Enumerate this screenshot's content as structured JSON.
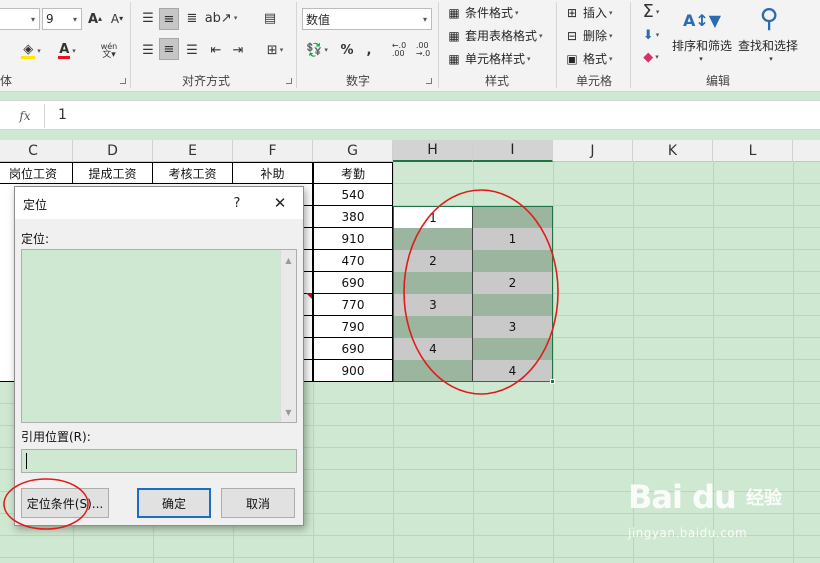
{
  "ribbon": {
    "font_size_value": "9",
    "font_group_label": "体",
    "align_group_label": "对齐方式",
    "number_group_label": "数字",
    "number_format_value": "数值",
    "percent_symbol": "%",
    "comma_symbol": ",",
    "style_group_label": "样式",
    "style_items": [
      "条件格式",
      "套用表格格式",
      "单元格样式"
    ],
    "cells_group_label": "单元格",
    "cells_items": [
      "插入",
      "删除",
      "格式"
    ],
    "edit_group_label": "编辑",
    "sort_filter_label": "排序和筛选",
    "find_select_label": "查找和选择"
  },
  "formula_bar": {
    "fx_label": "fx",
    "value": "1"
  },
  "columns": [
    "C",
    "D",
    "E",
    "F",
    "G",
    "H",
    "I",
    "J",
    "K",
    "L"
  ],
  "table": {
    "headers": [
      "岗位工资",
      "提成工资",
      "考核工资",
      "补助",
      "考勤"
    ],
    "attendance": [
      "540",
      "380",
      "910",
      "470",
      "690",
      "770",
      "790",
      "690",
      "900"
    ]
  },
  "selection_cells": {
    "h": [
      "1",
      "",
      "2",
      "",
      "3",
      "",
      "4",
      ""
    ],
    "i": [
      "",
      "1",
      "",
      "2",
      "",
      "3",
      "",
      "4"
    ]
  },
  "dialog": {
    "title": "定位",
    "help": "?",
    "close": "✕",
    "goto_label": "定位:",
    "reference_label": "引用位置(R):",
    "special_button": "定位条件(S)...",
    "ok_button": "确定",
    "cancel_button": "取消"
  },
  "watermark": {
    "brand": "Bai du",
    "cn": "经验",
    "url": "jingyan.baidu.com"
  },
  "colors": {
    "grid_bg": "#cfe8d1",
    "selection_dark": "#9bb59f",
    "selection_light": "#c9c9c9",
    "excel_green": "#217346",
    "annotation_red": "#e11b1b"
  }
}
